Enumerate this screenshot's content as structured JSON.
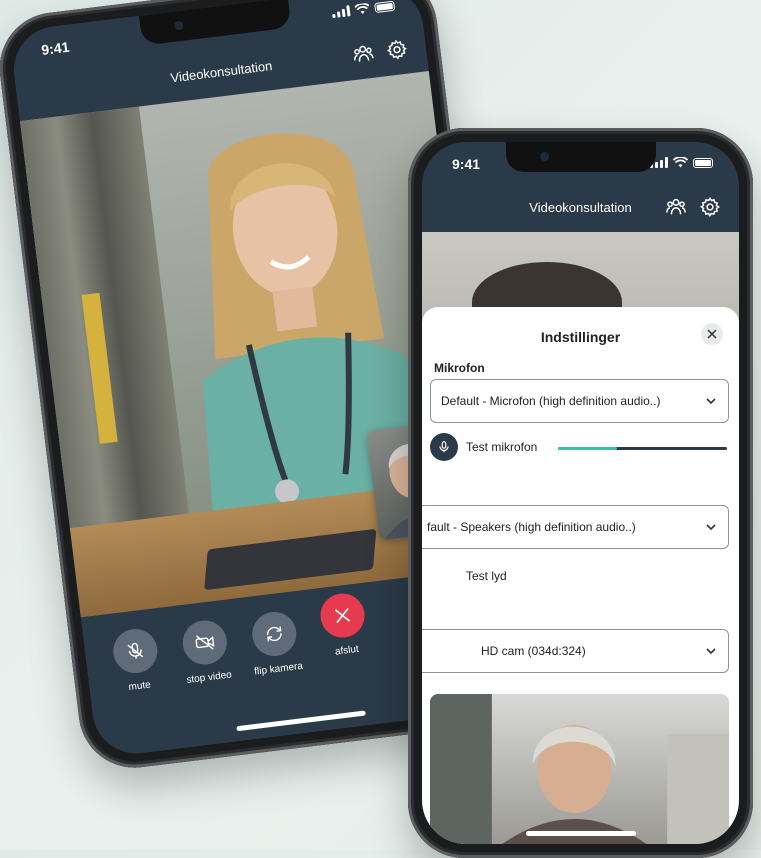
{
  "phone1": {
    "status": {
      "time": "9:41"
    },
    "header": {
      "title": "Videokonsultation"
    },
    "controls": [
      {
        "label": "mute",
        "icon": "mic-off-icon"
      },
      {
        "label": "stop video",
        "icon": "video-off-icon"
      },
      {
        "label": "flip kamera",
        "icon": "camera-flip-icon"
      },
      {
        "label": "afslut",
        "icon": "end-call-icon"
      }
    ]
  },
  "phone2": {
    "status": {
      "time": "9:41"
    },
    "header": {
      "title": "Videokonsultation"
    },
    "settings": {
      "title": "Indstillinger",
      "microphone": {
        "label": "Mikrofon",
        "selected": "Default - Microfon (high definition audio..)",
        "test_label": "Test mikrofon",
        "level": 0.35
      },
      "speakers": {
        "selected": "fault - Speakers (high definition audio..)",
        "test_label": "Test lyd"
      },
      "camera": {
        "selected": "HD cam (034d:324)"
      }
    }
  },
  "colors": {
    "primary": "#2b3a48",
    "accent": "#3bbfa8",
    "end_call": "#e63a4e"
  }
}
